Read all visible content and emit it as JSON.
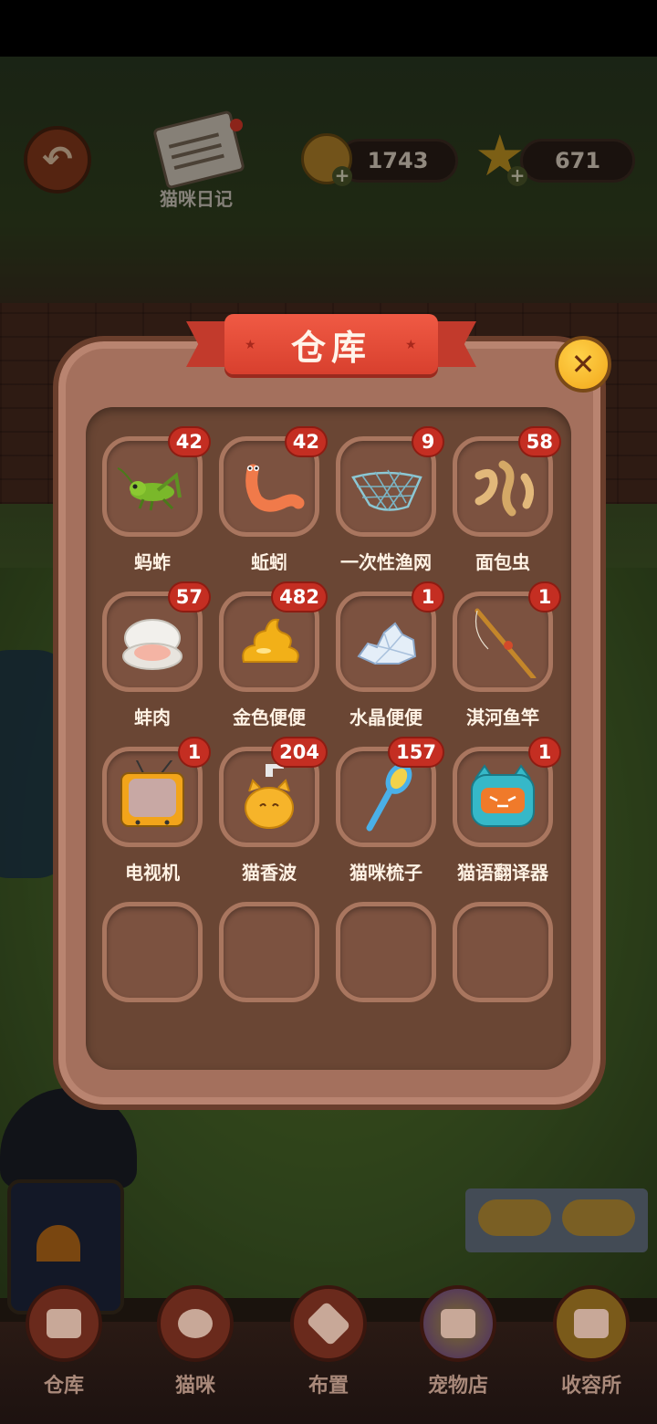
{
  "hud": {
    "diary_label": "猫咪日记",
    "coins": "1743",
    "stars": "671"
  },
  "panel": {
    "title": "仓库",
    "cut_row_labels": [
      "",
      "",
      "",
      ""
    ]
  },
  "items": [
    {
      "name": "蚂蚱",
      "count": "42",
      "icon": "grasshopper-icon"
    },
    {
      "name": "蚯蚓",
      "count": "42",
      "icon": "earthworm-icon"
    },
    {
      "name": "一次性渔网",
      "count": "9",
      "icon": "fishing-net-icon"
    },
    {
      "name": "面包虫",
      "count": "58",
      "icon": "mealworm-icon"
    },
    {
      "name": "蚌肉",
      "count": "57",
      "icon": "clam-meat-icon"
    },
    {
      "name": "金色便便",
      "count": "482",
      "icon": "golden-poop-icon"
    },
    {
      "name": "水晶便便",
      "count": "1",
      "icon": "crystal-poop-icon"
    },
    {
      "name": "淇河鱼竿",
      "count": "1",
      "icon": "fishing-rod-icon"
    },
    {
      "name": "电视机",
      "count": "1",
      "icon": "tv-icon"
    },
    {
      "name": "猫香波",
      "count": "204",
      "icon": "cat-shampoo-icon"
    },
    {
      "name": "猫咪梳子",
      "count": "157",
      "icon": "cat-comb-icon"
    },
    {
      "name": "猫语翻译器",
      "count": "1",
      "icon": "cat-translator-icon"
    }
  ],
  "nav": {
    "items": [
      {
        "label": "仓库",
        "icon": "warehouse-icon"
      },
      {
        "label": "猫咪",
        "icon": "paw-icon"
      },
      {
        "label": "布置",
        "icon": "arrange-icon"
      },
      {
        "label": "宠物店",
        "icon": "pet-shop-icon"
      },
      {
        "label": "收容所",
        "icon": "shelter-icon"
      }
    ]
  }
}
